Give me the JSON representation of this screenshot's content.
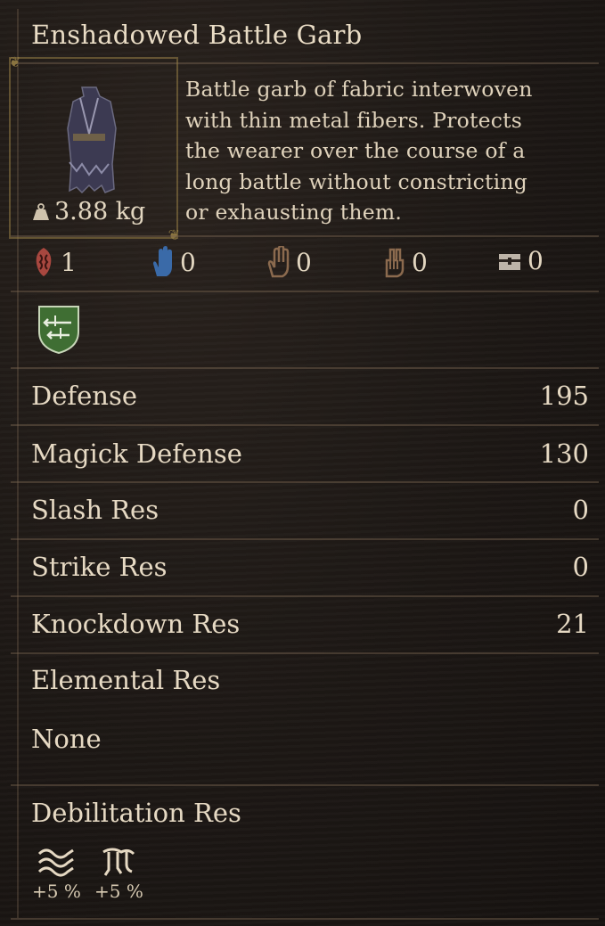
{
  "item": {
    "title": "Enshadowed Battle Garb",
    "weight": "3.88 kg",
    "description_lines": [
      "Battle garb of fabric interwoven",
      "with thin metal fibers. Protects",
      "the wearer over the course of a",
      "long battle without constricting",
      "or exhausting them."
    ],
    "icon_name": "armor-garb-icon"
  },
  "requirements": [
    {
      "icon": "red-crest-icon",
      "value": "1",
      "color": "#b4514a"
    },
    {
      "icon": "blue-hand-icon",
      "value": "0",
      "color": "#3f6fa8"
    },
    {
      "icon": "brown-hand-icon",
      "value": "0",
      "color": "#8b6a4e"
    },
    {
      "icon": "brown-fist-icon",
      "value": "0",
      "color": "#8b6a4e"
    },
    {
      "icon": "chest-icon",
      "value": "0",
      "color": "#c9c0b4"
    }
  ],
  "vocation_badge": {
    "icon": "swords-shield-icon",
    "color": "#4a7a3a"
  },
  "stats": [
    {
      "label": "Defense",
      "value": "195"
    },
    {
      "label": "Magick Defense",
      "value": "130"
    },
    {
      "label": "Slash Res",
      "value": "0"
    },
    {
      "label": "Strike Res",
      "value": "0"
    },
    {
      "label": "Knockdown Res",
      "value": "21"
    }
  ],
  "elemental": {
    "label": "Elemental Res",
    "value": "None"
  },
  "debilitation": {
    "label": "Debilitation Res",
    "items": [
      {
        "icon": "wind-waves-icon",
        "value": "+5 %"
      },
      {
        "icon": "claw-icon",
        "value": "+5 %"
      }
    ]
  }
}
